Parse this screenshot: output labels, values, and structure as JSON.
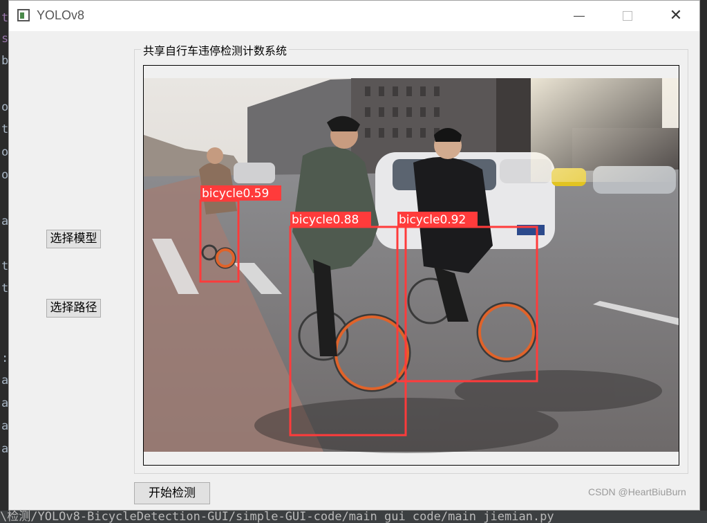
{
  "window": {
    "title": "YOLOv8",
    "group_title": "共享自行车违停检测计数系统"
  },
  "buttons": {
    "select_model": "选择模型",
    "select_path": "选择路径",
    "start_detection": "开始检测"
  },
  "detections": [
    {
      "label": "bicycle0.59",
      "color": "#ff3b3b"
    },
    {
      "label": "bicycle0.88",
      "color": "#ff3b3b"
    },
    {
      "label": "bicycle0.92",
      "color": "#ff3b3b"
    }
  ],
  "editor": {
    "gutter_chars": [
      "t",
      "s",
      "b",
      "o",
      "t",
      "o",
      "o",
      "a",
      "t",
      "t",
      ":",
      "a",
      "a",
      "a",
      "a"
    ],
    "status_path": "\\检测/YOLOv8-BicycleDetection-GUI/simple-GUI-code/main gui code/main jiemian.py"
  },
  "watermark": "CSDN @HeartBiuBurn",
  "colors": {
    "window_bg": "#f0f0f0",
    "box_color": "#ff3b3b",
    "editor_bg": "#2b2b2b"
  }
}
